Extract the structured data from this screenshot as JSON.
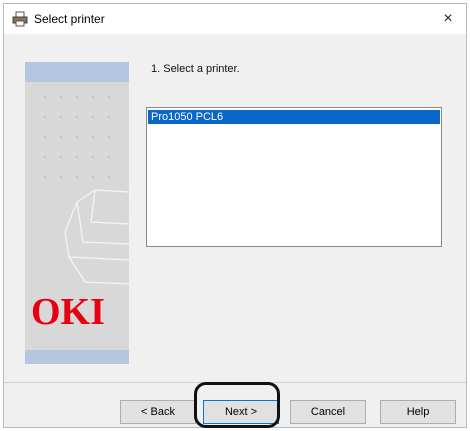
{
  "window": {
    "title": "Select printer",
    "close_symbol": "×"
  },
  "icons": {
    "title": "printer-icon",
    "close": "close-icon"
  },
  "banner": {
    "brand": "OKI",
    "brand_color": "#e60012"
  },
  "main": {
    "step_label": "1. Select a printer.",
    "printers": [
      {
        "name": "Pro1050 PCL6",
        "selected": true
      }
    ]
  },
  "buttons": {
    "back": "< Back",
    "next": "Next >",
    "cancel": "Cancel",
    "help": "Help"
  },
  "colors": {
    "selection": "#0a66c8",
    "banner_band": "#b5c6e0",
    "banner_bg": "#d8d8d8"
  }
}
